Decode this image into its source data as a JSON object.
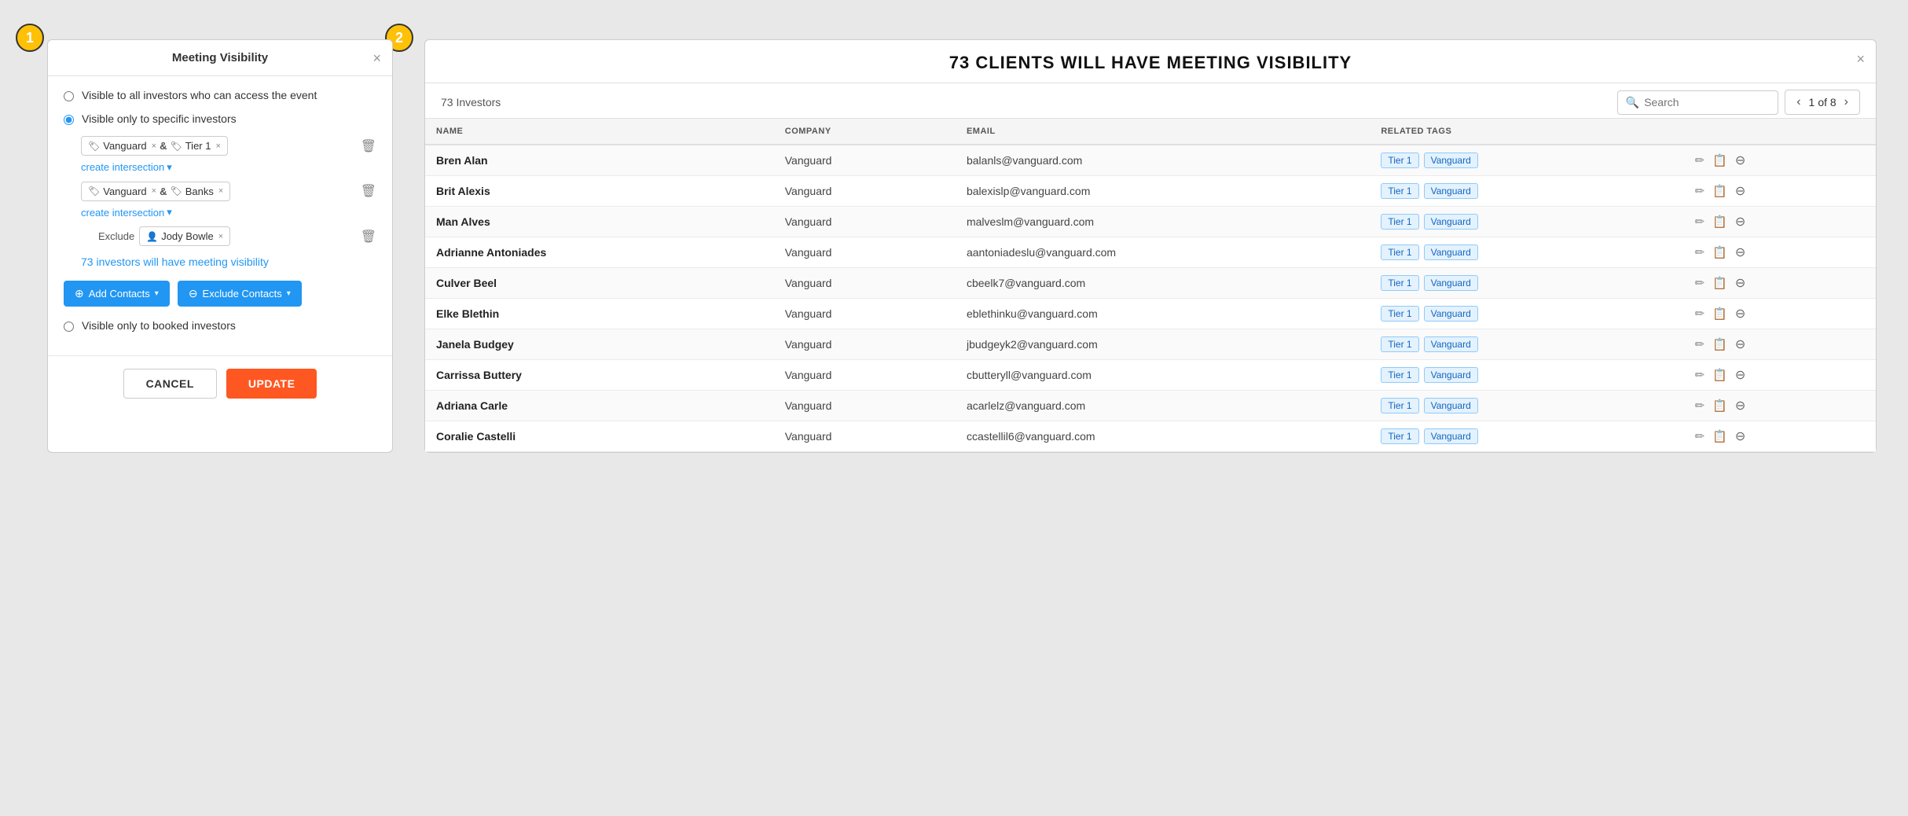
{
  "leftPanel": {
    "title": "Meeting Visibility",
    "closeLabel": "×",
    "options": [
      {
        "id": "opt1",
        "label": "Visible to all investors who can access the event",
        "checked": false
      },
      {
        "id": "opt2",
        "label": "Visible only to specific investors",
        "checked": true
      },
      {
        "id": "opt3",
        "label": "Visible only to booked investors",
        "checked": false
      }
    ],
    "tagRows": [
      {
        "tags": [
          {
            "name": "Vanguard",
            "type": "tag"
          },
          {
            "connector": "&"
          },
          {
            "name": "Tier 1",
            "type": "tag"
          }
        ],
        "createIntersectionLabel": "create intersection"
      },
      {
        "tags": [
          {
            "name": "Vanguard",
            "type": "tag"
          },
          {
            "connector": "&"
          },
          {
            "name": "Banks",
            "type": "tag"
          }
        ],
        "createIntersectionLabel": "create intersection"
      }
    ],
    "excludeRow": {
      "label": "Exclude",
      "contact": "Jody Bowle"
    },
    "visibilityCount": "73 investors will have meeting visibility",
    "addContactsLabel": "Add Contacts",
    "excludeContactsLabel": "Exclude Contacts",
    "cancelLabel": "CANCEL",
    "updateLabel": "UPDATE"
  },
  "rightPanel": {
    "title": "73 CLIENTS WILL HAVE MEETING VISIBILITY",
    "closeLabel": "×",
    "investorsCount": "73 Investors",
    "searchPlaceholder": "Search",
    "pagination": {
      "current": "1",
      "total": "8",
      "ofLabel": "of 8"
    },
    "table": {
      "headers": [
        "NAME",
        "COMPANY",
        "EMAIL",
        "RELATED TAGS",
        ""
      ],
      "rows": [
        {
          "name": "Bren Alan",
          "company": "Vanguard",
          "email": "balanls@vanguard.com",
          "tags": [
            "Tier 1",
            "Vanguard"
          ]
        },
        {
          "name": "Brit Alexis",
          "company": "Vanguard",
          "email": "balexislp@vanguard.com",
          "tags": [
            "Tier 1",
            "Vanguard"
          ]
        },
        {
          "name": "Man Alves",
          "company": "Vanguard",
          "email": "malveslm@vanguard.com",
          "tags": [
            "Tier 1",
            "Vanguard"
          ]
        },
        {
          "name": "Adrianne Antoniades",
          "company": "Vanguard",
          "email": "aantoniadeslu@vanguard.com",
          "tags": [
            "Tier 1",
            "Vanguard"
          ]
        },
        {
          "name": "Culver Beel",
          "company": "Vanguard",
          "email": "cbeelk7@vanguard.com",
          "tags": [
            "Tier 1",
            "Vanguard"
          ]
        },
        {
          "name": "Elke Blethin",
          "company": "Vanguard",
          "email": "eblethinku@vanguard.com",
          "tags": [
            "Tier 1",
            "Vanguard"
          ]
        },
        {
          "name": "Janela Budgey",
          "company": "Vanguard",
          "email": "jbudgeyk2@vanguard.com",
          "tags": [
            "Tier 1",
            "Vanguard"
          ]
        },
        {
          "name": "Carrissa Buttery",
          "company": "Vanguard",
          "email": "cbutteryll@vanguard.com",
          "tags": [
            "Tier 1",
            "Vanguard"
          ]
        },
        {
          "name": "Adriana Carle",
          "company": "Vanguard",
          "email": "acarlelz@vanguard.com",
          "tags": [
            "Tier 1",
            "Vanguard"
          ]
        },
        {
          "name": "Coralie Castelli",
          "company": "Vanguard",
          "email": "ccastellil6@vanguard.com",
          "tags": [
            "Tier 1",
            "Vanguard"
          ]
        }
      ]
    }
  },
  "badges": {
    "left": "1",
    "right": "2"
  }
}
